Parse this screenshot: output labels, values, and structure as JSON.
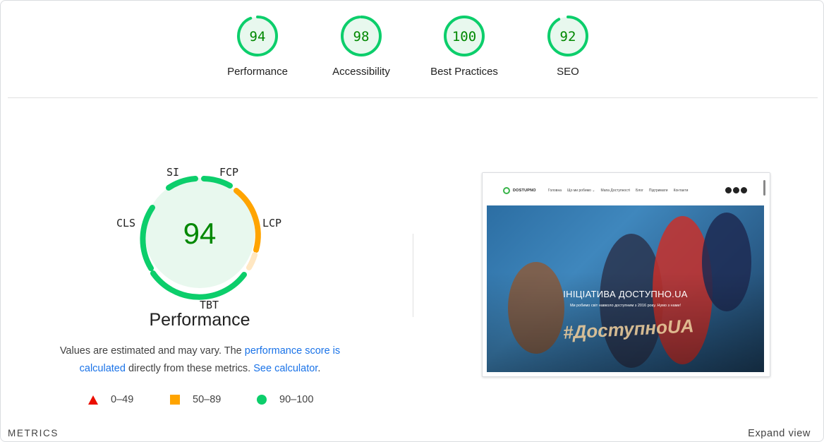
{
  "colors": {
    "pass": "#0cce6b",
    "pass_text": "#008800",
    "pass_fill": "#e8f8ee",
    "average": "#ffa400",
    "fail": "#eb0f00",
    "link": "#1a73e8"
  },
  "scores": [
    {
      "label": "Performance",
      "value": "94",
      "score": 0.94
    },
    {
      "label": "Accessibility",
      "value": "98",
      "score": 0.98
    },
    {
      "label": "Best Practices",
      "value": "100",
      "score": 1.0
    },
    {
      "label": "SEO",
      "value": "92",
      "score": 0.92
    }
  ],
  "performance_gauge": {
    "score": "94",
    "title": "Performance",
    "metrics": {
      "si": "SI",
      "fcp": "FCP",
      "lcp": "LCP",
      "tbt": "TBT",
      "cls": "CLS"
    }
  },
  "estimate": {
    "text_before": "Values are estimated and may vary. The ",
    "link_score": "performance score is calculated",
    "text_middle": " directly from these metrics. ",
    "link_calculator": "See calculator",
    "text_after": "."
  },
  "legend": {
    "fail": "0–49",
    "average": "50–89",
    "pass": "90–100"
  },
  "screenshot": {
    "logo": "DOSTUPNO",
    "nav": [
      "Головна",
      "Що ми робимо ⌄",
      "Мапа Доступності",
      "Блог",
      "Підтримати",
      "Контакти"
    ],
    "hero_title": "ІНІЦІАТИВА ДОСТУПНО.UA",
    "hero_subtitle": "Ми робимо світ навколо доступним з 2016 року. Нумо з нами!",
    "hero_sign": "#ДоступноUA"
  },
  "footer": {
    "metrics": "METRICS",
    "expand": "Expand view"
  }
}
